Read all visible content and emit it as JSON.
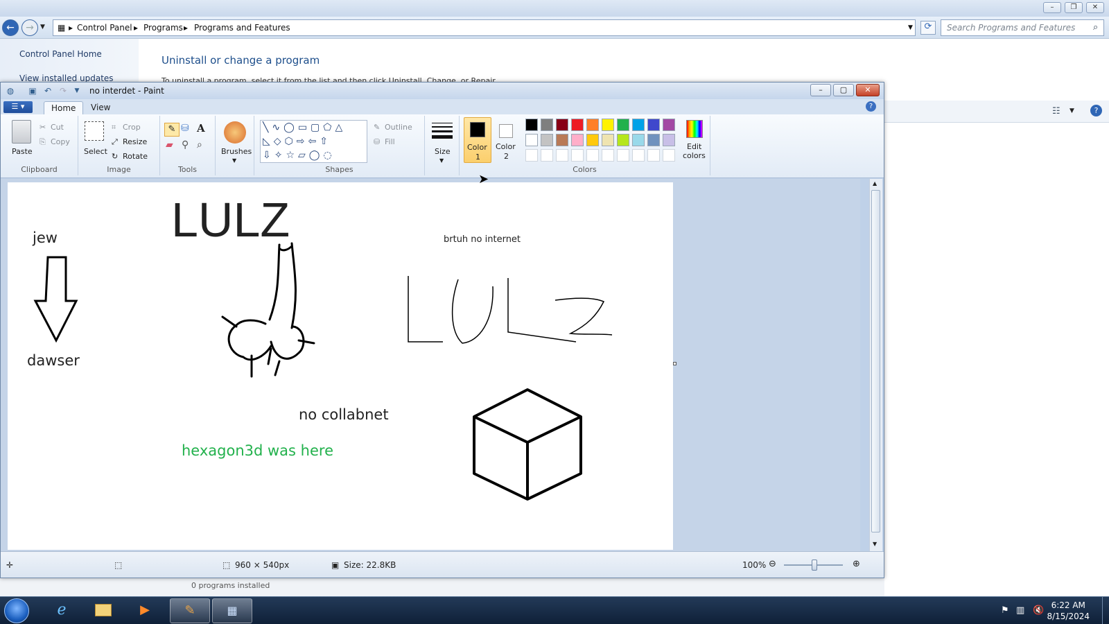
{
  "explorer": {
    "breadcrumbs": [
      "Control Panel",
      "Programs",
      "Programs and Features"
    ],
    "search_placeholder": "Search Programs and Features",
    "sidebar_links": [
      "Control Panel Home",
      "View installed updates"
    ],
    "heading": "Uninstall or change a program",
    "subtext": "To uninstall a program, select it from the list and then click Uninstall, Change, or Repair.",
    "footer": "0 programs installed"
  },
  "paint": {
    "title": "no interdet - Paint",
    "tabs": [
      "Home",
      "View"
    ],
    "clipboard": {
      "paste": "Paste",
      "cut": "Cut",
      "copy": "Copy",
      "group": "Clipboard"
    },
    "image": {
      "select": "Select",
      "crop": "Crop",
      "resize": "Resize",
      "rotate": "Rotate",
      "group": "Image"
    },
    "tools": {
      "group": "Tools"
    },
    "brushes": "Brushes",
    "shapes": {
      "outline": "Outline",
      "fill": "Fill",
      "group": "Shapes"
    },
    "size": "Size",
    "color1": {
      "line1": "Color",
      "line2": "1"
    },
    "color2": {
      "line1": "Color",
      "line2": "2"
    },
    "colors_group": "Colors",
    "edit_colors": {
      "line1": "Edit",
      "line2": "colors"
    },
    "palette_row1": [
      "#000000",
      "#7f7f7f",
      "#880015",
      "#ed1c24",
      "#ff7f27",
      "#fff200",
      "#22b14c",
      "#00a2e8",
      "#3f48cc",
      "#a349a4"
    ],
    "palette_row2": [
      "#ffffff",
      "#c3c3c3",
      "#b97a57",
      "#ffaec9",
      "#ffc90e",
      "#efe4b0",
      "#b5e61d",
      "#99d9ea",
      "#7092be",
      "#c8bfe7"
    ],
    "canvas_text": {
      "lulz": "LULZ",
      "jew": "jew",
      "dawser": "dawser",
      "brtuh": "brtuh no internet",
      "collabnet": "no collabnet",
      "hexagon": "hexagon3d was here"
    },
    "status": {
      "dimensions": "960 × 540px",
      "size": "Size: 22.8KB",
      "zoom": "100%"
    }
  },
  "taskbar": {
    "time": "6:22 AM",
    "date": "8/15/2024"
  },
  "colors": {
    "hexagon_text": "#22b14c"
  }
}
